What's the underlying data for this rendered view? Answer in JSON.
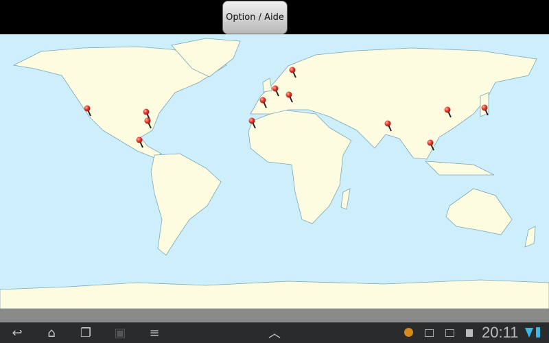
{
  "top_bar": {
    "option_button": "Option / Aide"
  },
  "status_bar": {
    "time": "20:11"
  },
  "colors": {
    "ocean": "#cdeefb",
    "land": "#fefce0",
    "pin": "#e53b2f"
  }
}
